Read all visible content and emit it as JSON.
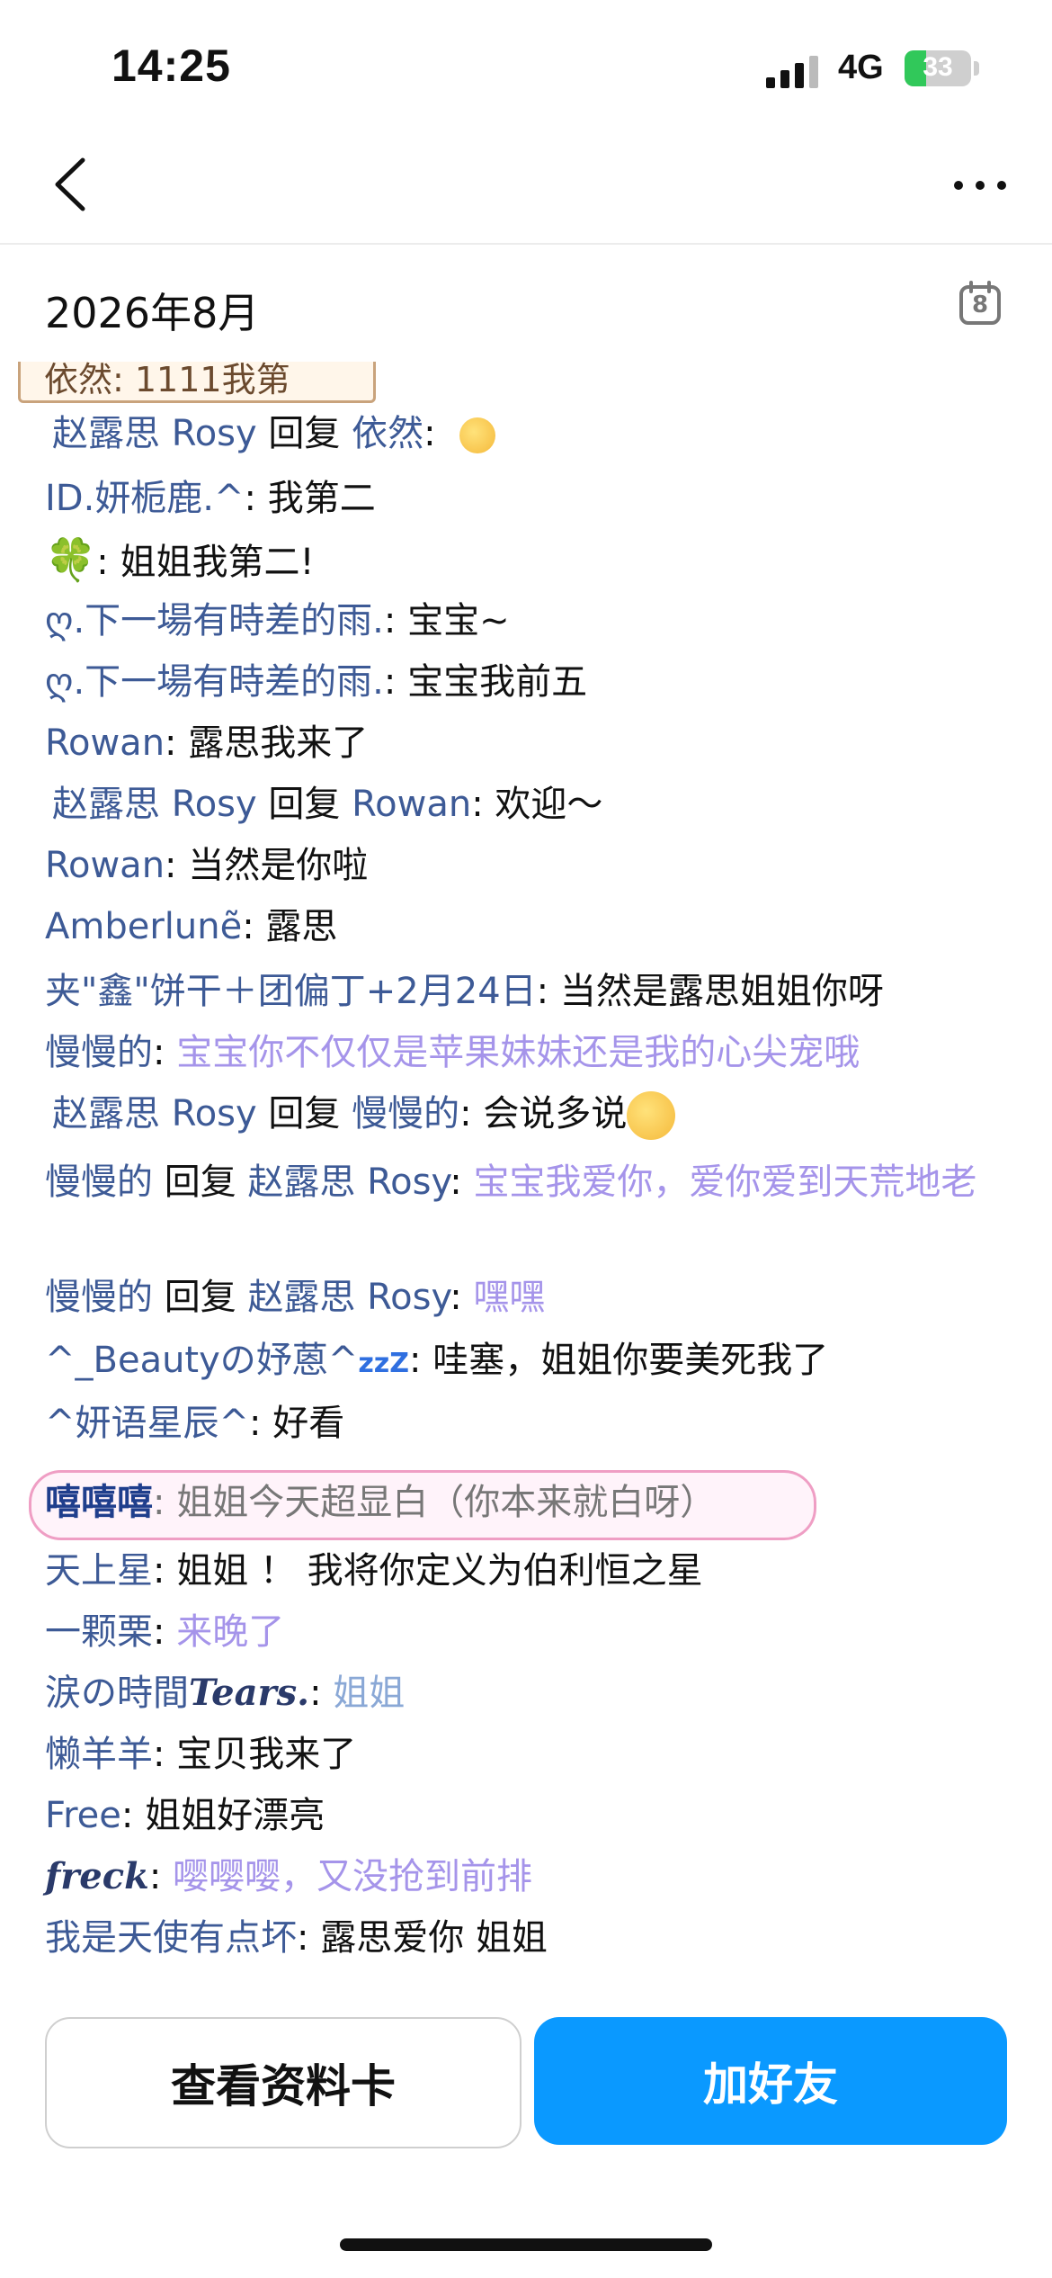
{
  "status_bar": {
    "time": "14:25",
    "network": "4G",
    "battery": "33",
    "battery_level": 0.33
  },
  "nav": {
    "back_icon": "chevron-left-icon",
    "more_icon": "ellipsis-icon"
  },
  "month_row": {
    "label": "2026年8月",
    "calendar_day": "8",
    "calendar_icon": "calendar-icon"
  },
  "cut_bubble_text": "依然: 1111我第",
  "messages": [
    {
      "name": "赵露思 Rosy",
      "reply": " 回复 ",
      "target": "依然",
      "sep": ": ",
      "text": "",
      "emoji": "face-icon"
    },
    {
      "name": "ID.妍栀鹿.^",
      "sep": ": ",
      "text": "我第二"
    },
    {
      "name": "🍀",
      "sep": ": ",
      "text": "姐姐我第二!"
    },
    {
      "name": "ღ.下一場有時差的雨.",
      "sep": ": ",
      "text": "宝宝~"
    },
    {
      "name": "ღ.下一場有時差的雨.",
      "sep": ": ",
      "text": "宝宝我前五"
    },
    {
      "name": "Rowan",
      "sep": ": ",
      "text": "露思我来了"
    },
    {
      "name": "赵露思 Rosy",
      "reply": " 回复 ",
      "target": "Rowan",
      "sep": ": ",
      "text": "欢迎～"
    },
    {
      "name": "Rowan",
      "sep": ": ",
      "text": "当然是你啦"
    },
    {
      "name": "Amberlunẽ",
      "sep": ": ",
      "text": "露思"
    },
    {
      "name": "夹\"鑫\"饼干＋团偏丁+2月24日",
      "sep": ": ",
      "text": "当然是露思姐姐你呀"
    },
    {
      "name": "慢慢的",
      "sep": ": ",
      "text": "宝宝你不仅仅是苹果妹妹还是我的心尖宠哦"
    },
    {
      "name": "赵露思 Rosy",
      "reply": " 回复 ",
      "target": "慢慢的",
      "sep": ": ",
      "text": "会说多说",
      "emoji": "face-icon"
    },
    {
      "name": "慢慢的",
      "reply": " 回复 ",
      "target": "赵露思 Rosy",
      "sep": ": ",
      "text": "宝宝我爱你，爱你爱到天荒地老"
    },
    {
      "name": "慢慢的",
      "reply": " 回复 ",
      "target": "赵露思 Rosy",
      "sep": ": ",
      "text": "嘿嘿"
    },
    {
      "name": "^_Beautyの妤蒽^",
      "name_suffix": "zzZ",
      "sep": ": ",
      "text": "哇塞，姐姐你要美死我了"
    },
    {
      "name": "^妍语星辰^",
      "sep": ": ",
      "text": "好看"
    },
    {
      "name": "嘻嘻嘻",
      "sep": ": ",
      "text": "姐姐今天超显白（你本来就白呀）"
    },
    {
      "name": "天上星",
      "sep": ": ",
      "text": "姐姐 ！ 我将你定义为伯利恒之星"
    },
    {
      "name": "一颗栗",
      "sep": ": ",
      "text": "来晚了"
    },
    {
      "name": "涙の時間",
      "name_script": "Tears.",
      "sep": ": ",
      "text": "姐姐"
    },
    {
      "name": "懒羊羊",
      "sep": ": ",
      "text": "宝贝我来了"
    },
    {
      "name": "Free",
      "sep": ": ",
      "text": "姐姐好漂亮"
    },
    {
      "name": "freck",
      "sep": ": ",
      "text": "嘤嘤嘤，又没抢到前排"
    },
    {
      "name": "我是天使有点坏",
      "sep": ": ",
      "text": "露思爱你 姐姐"
    }
  ],
  "buttons": {
    "profile_card": "查看资料卡",
    "add_friend": "加好友"
  },
  "colors": {
    "name": "#3d5a96",
    "purple_text": "#a594ea",
    "blue_text": "#8aa8d6",
    "add_button": "#0a99ff",
    "pink_bubble": "#ef9ec4"
  }
}
